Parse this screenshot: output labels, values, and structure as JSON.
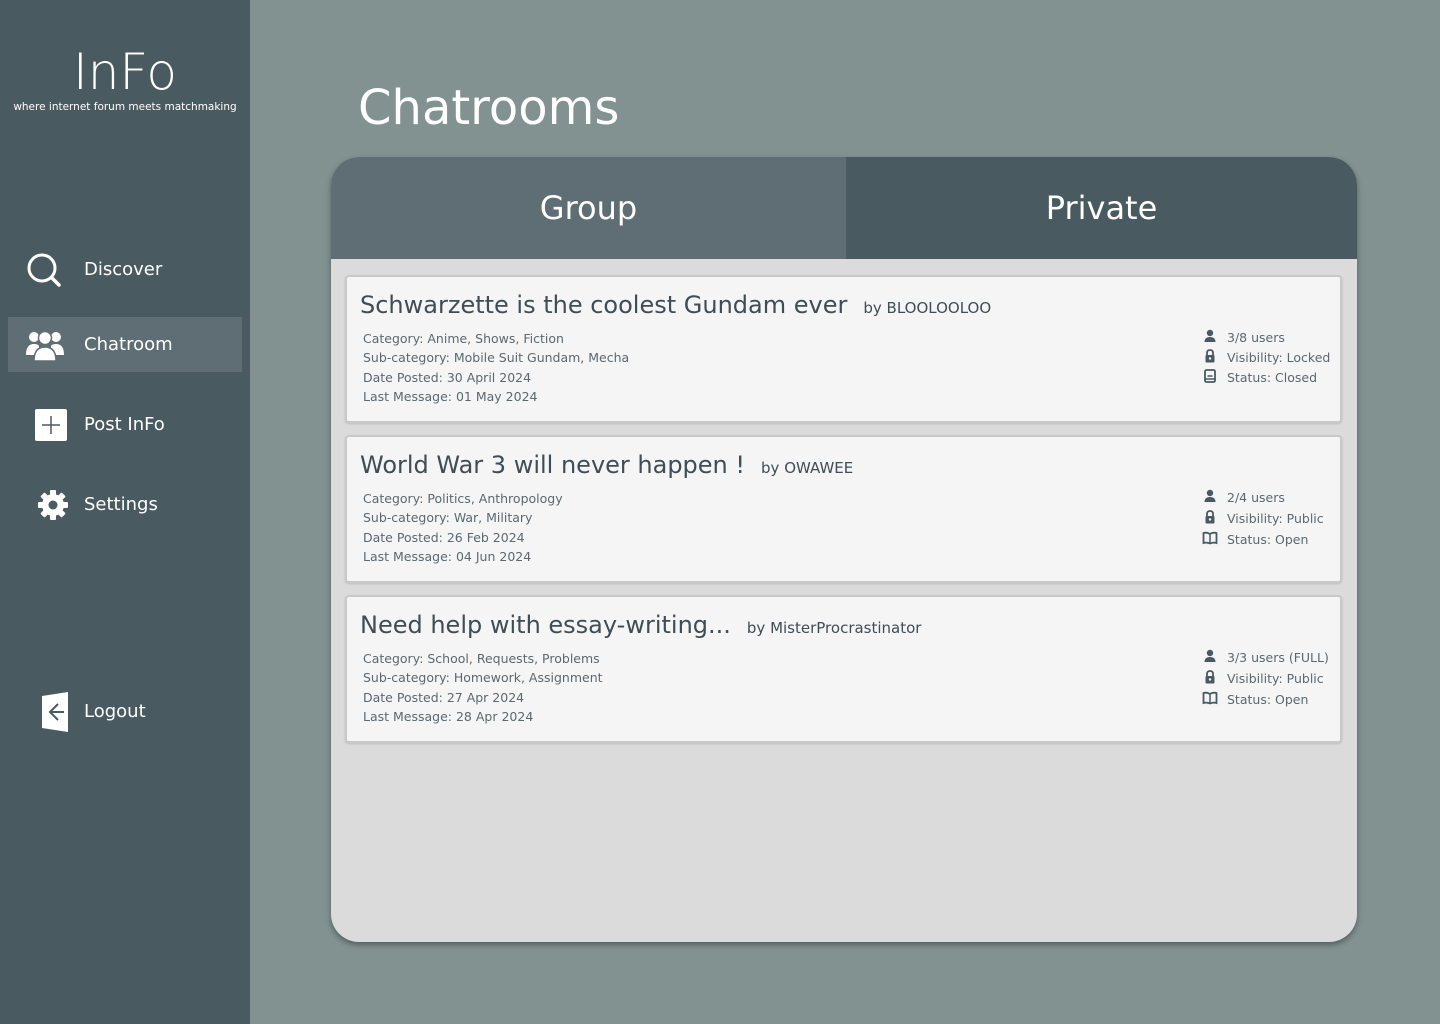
{
  "app": {
    "name": "InFo",
    "tagline": "where internet forum meets matchmaking"
  },
  "sidebar": {
    "items": [
      {
        "label": "Discover",
        "icon": "search-icon",
        "active": false
      },
      {
        "label": "Chatroom",
        "icon": "users-icon",
        "active": true
      },
      {
        "label": "Post InFo",
        "icon": "plus-icon",
        "active": false
      },
      {
        "label": "Settings",
        "icon": "gear-icon",
        "active": false
      }
    ],
    "logout": {
      "label": "Logout",
      "icon": "logout-icon"
    }
  },
  "page": {
    "title": "Chatrooms"
  },
  "tabs": [
    {
      "label": "Group",
      "selected": true
    },
    {
      "label": "Private",
      "selected": false
    }
  ],
  "chatrooms": [
    {
      "title": "Schwarzette is the coolest Gundam ever",
      "author": "by BLOOLOOLOO",
      "category": "Category:  Anime, Shows, Fiction",
      "subcategory": "Sub-category:  Mobile Suit Gundam, Mecha",
      "date_posted": "Date Posted: 30 April 2024",
      "last_message": "Last Message: 01 May 2024",
      "users": "3/8 users",
      "visibility": "Visibility: Locked",
      "status": "Status: Closed",
      "visibility_icon": "lock-icon",
      "status_icon": "closed-book-icon"
    },
    {
      "title": "World War 3 will never happen !",
      "author": "by OWAWEE",
      "category": "Category:  Politics, Anthropology",
      "subcategory": "Sub-category:  War, Military",
      "date_posted": "Date Posted: 26 Feb 2024",
      "last_message": "Last Message: 04 Jun 2024",
      "users": "2/4 users",
      "visibility": "Visibility: Public",
      "status": "Status: Open",
      "visibility_icon": "unlock-icon",
      "status_icon": "open-book-icon"
    },
    {
      "title": "Need help with essay-writing...",
      "author": "by MisterProcrastinator",
      "category": "Category:  School, Requests, Problems",
      "subcategory": "Sub-category:  Homework, Assignment",
      "date_posted": "Date Posted: 27 Apr 2024",
      "last_message": "Last Message: 28 Apr 2024",
      "users": "3/3 users (FULL)",
      "visibility": "Visibility: Public",
      "status": "Status: Open",
      "visibility_icon": "unlock-icon",
      "status_icon": "open-book-icon"
    }
  ],
  "colors": {
    "sidebar": "#4a5a61",
    "sidebar_active": "#5f6e75",
    "background": "#819291",
    "panel": "#dbdbdb",
    "card": "#f5f5f5",
    "text_dark": "#3f4d54"
  }
}
